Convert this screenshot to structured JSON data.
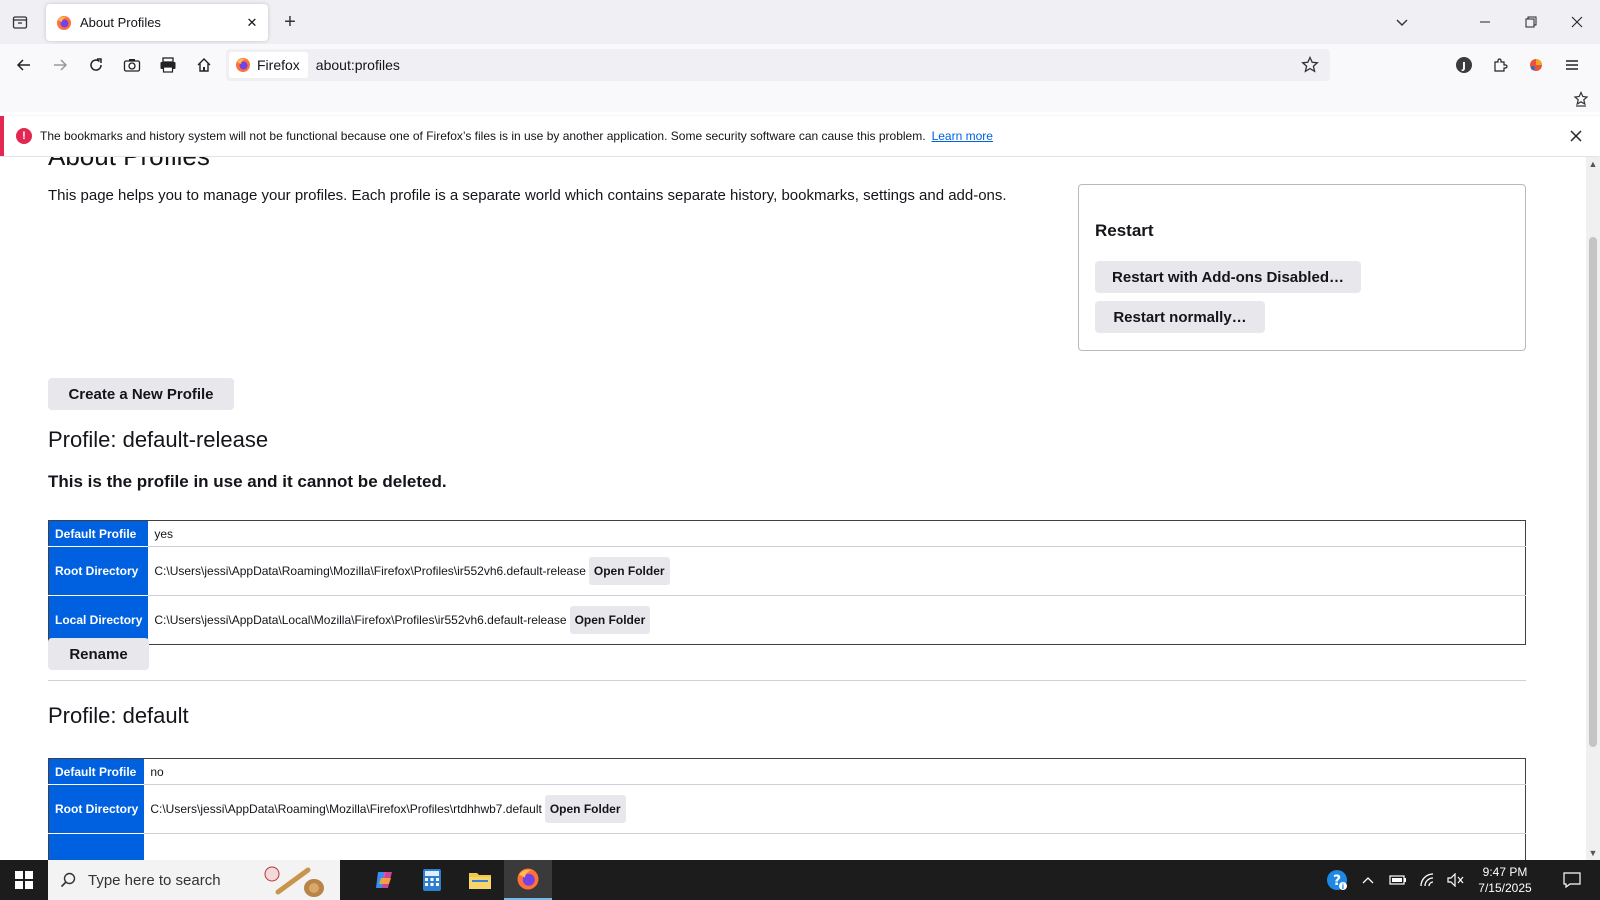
{
  "browser": {
    "tab": {
      "title": "About Profiles"
    },
    "url_identity": "Firefox",
    "url": "about:profiles"
  },
  "notification": {
    "message": "The bookmarks and history system will not be functional because one of Firefox’s files is in use by another application. Some security software can cause this problem.",
    "link": "Learn more"
  },
  "page": {
    "title": "About Profiles",
    "intro": "This page helps you to manage your profiles. Each profile is a separate world which contains separate history, bookmarks, settings and add-ons.",
    "restart": {
      "heading": "Restart",
      "addons_disabled_button": "Restart with Add-ons Disabled…",
      "normal_button": "Restart normally…"
    },
    "create_button": "Create a New Profile",
    "profiles": [
      {
        "title": "Profile: default-release",
        "note": "This is the profile in use and it cannot be deleted.",
        "rows": [
          {
            "label": "Default Profile",
            "value": "yes"
          },
          {
            "label": "Root Directory",
            "value": "C:\\Users\\jessi\\AppData\\Roaming\\Mozilla\\Firefox\\Profiles\\ir552vh6.default-release",
            "button": "Open Folder"
          },
          {
            "label": "Local Directory",
            "value": "C:\\Users\\jessi\\AppData\\Local\\Mozilla\\Firefox\\Profiles\\ir552vh6.default-release",
            "button": "Open Folder"
          }
        ],
        "rename_button": "Rename"
      },
      {
        "title": "Profile: default",
        "rows": [
          {
            "label": "Default Profile",
            "value": "no"
          },
          {
            "label": "Root Directory",
            "value": "C:\\Users\\jessi\\AppData\\Roaming\\Mozilla\\Firefox\\Profiles\\rtdhhwb7.default",
            "button": "Open Folder"
          }
        ]
      }
    ]
  },
  "taskbar": {
    "search_placeholder": "Type here to search",
    "time": "9:47 PM",
    "date": "7/15/2025"
  },
  "colors": {
    "accent": "#0061e0",
    "error": "#e22850",
    "taskbar": "#1c1c1c"
  }
}
